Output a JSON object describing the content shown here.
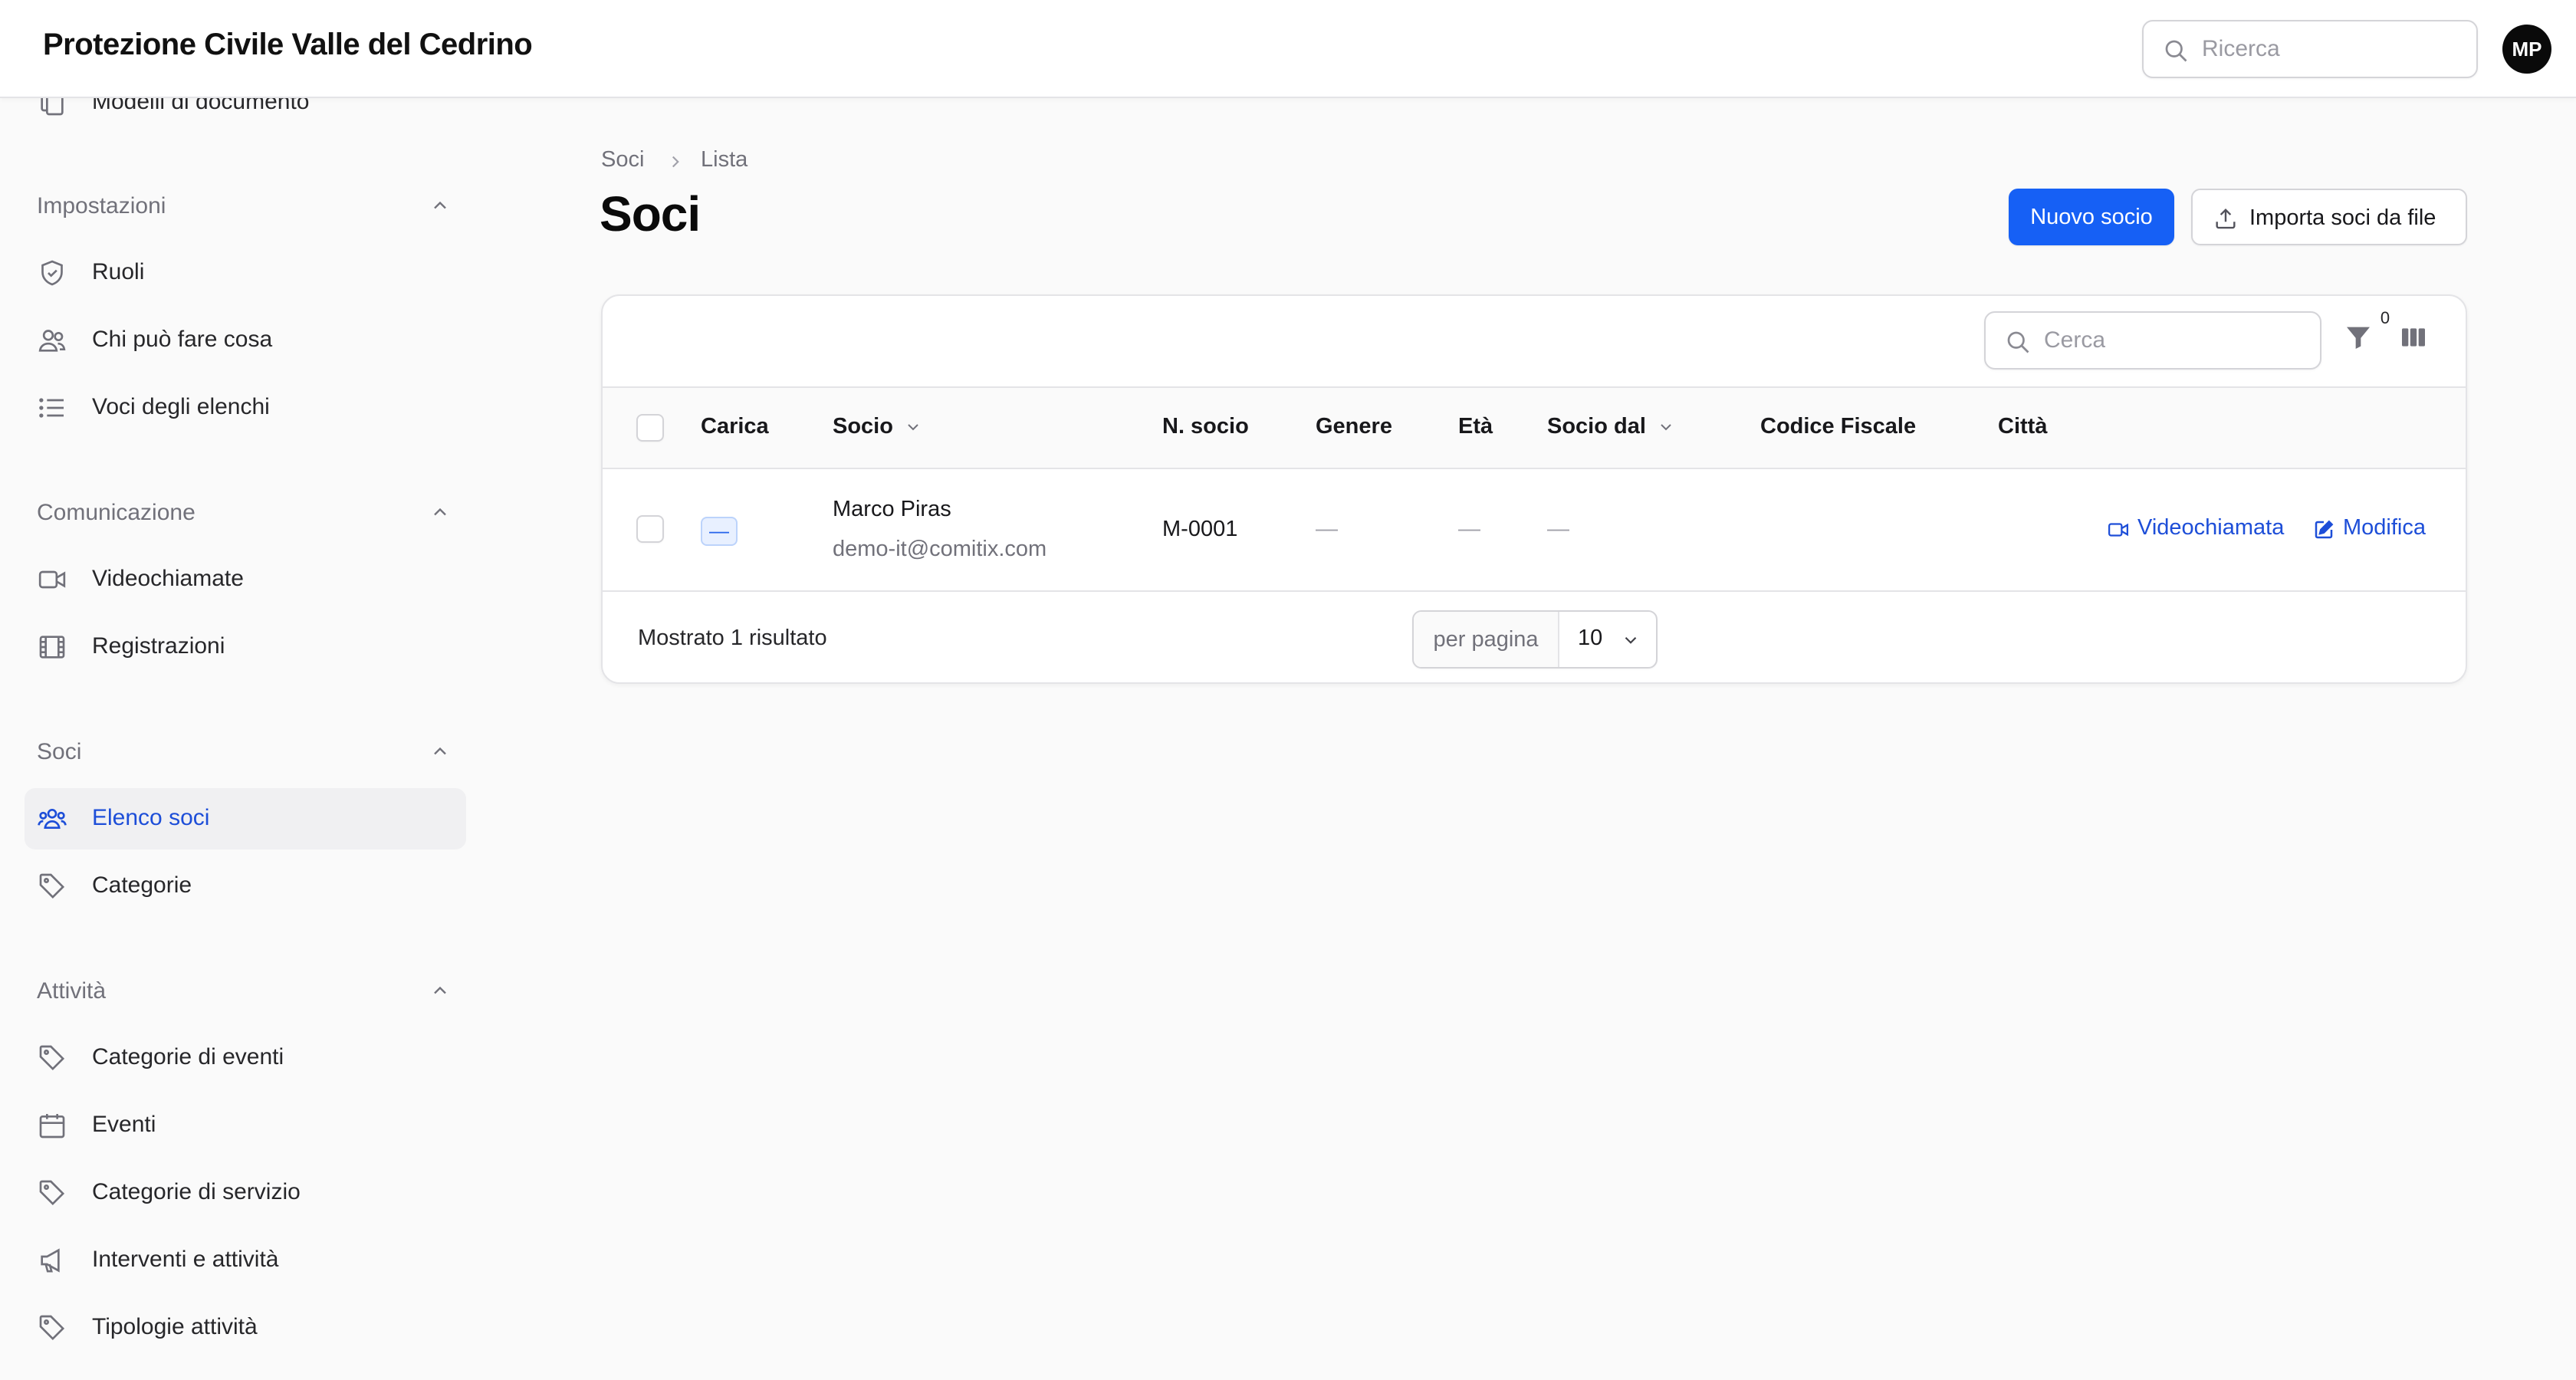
{
  "app": {
    "title": "Protezione Civile Valle del Cedrino",
    "search_placeholder": "Ricerca",
    "user_initials": "MP"
  },
  "sidebar": {
    "top_item": {
      "label": "Modelli di documento",
      "icon": "document-copy-icon"
    },
    "groups": [
      {
        "label": "Impostazioni",
        "items": [
          {
            "label": "Ruoli",
            "icon": "shield-check-icon"
          },
          {
            "label": "Chi può fare cosa",
            "icon": "users-icon"
          },
          {
            "label": "Voci degli elenchi",
            "icon": "list-icon"
          }
        ]
      },
      {
        "label": "Comunicazione",
        "items": [
          {
            "label": "Videochiamate",
            "icon": "video-camera-icon"
          },
          {
            "label": "Registrazioni",
            "icon": "film-icon"
          }
        ]
      },
      {
        "label": "Soci",
        "items": [
          {
            "label": "Elenco soci",
            "icon": "user-group-icon",
            "active": true
          },
          {
            "label": "Categorie",
            "icon": "tag-icon"
          }
        ]
      },
      {
        "label": "Attività",
        "items": [
          {
            "label": "Categorie di eventi",
            "icon": "tag-icon"
          },
          {
            "label": "Eventi",
            "icon": "calendar-icon"
          },
          {
            "label": "Categorie di servizio",
            "icon": "tag-icon"
          },
          {
            "label": "Interventi e attività",
            "icon": "megaphone-icon"
          },
          {
            "label": "Tipologie attività",
            "icon": "tag-icon"
          }
        ]
      }
    ]
  },
  "breadcrumb": [
    "Soci",
    "Lista"
  ],
  "page": {
    "title": "Soci",
    "new_button": "Nuovo socio",
    "import_button": "Importa soci da file"
  },
  "table": {
    "search_placeholder": "Cerca",
    "filter_count": "0",
    "columns": [
      "Carica",
      "Socio",
      "N. socio",
      "Genere",
      "Età",
      "Socio dal",
      "Codice Fiscale",
      "Città"
    ],
    "rows": [
      {
        "carica": "—",
        "name": "Marco Piras",
        "email": "demo-it@comitix.com",
        "number": "M-0001",
        "genere": "—",
        "eta": "—",
        "socio_dal": "—",
        "codice_fiscale": "",
        "citta": "",
        "actions": [
          "Videochiamata",
          "Modifica"
        ]
      }
    ],
    "footer": {
      "result_text": "Mostrato 1 risultato",
      "per_page_label": "per pagina",
      "per_page_value": "10"
    }
  },
  "colors": {
    "accent": "#1660f5",
    "link": "#1d4ed8",
    "background": "#fafafa"
  }
}
